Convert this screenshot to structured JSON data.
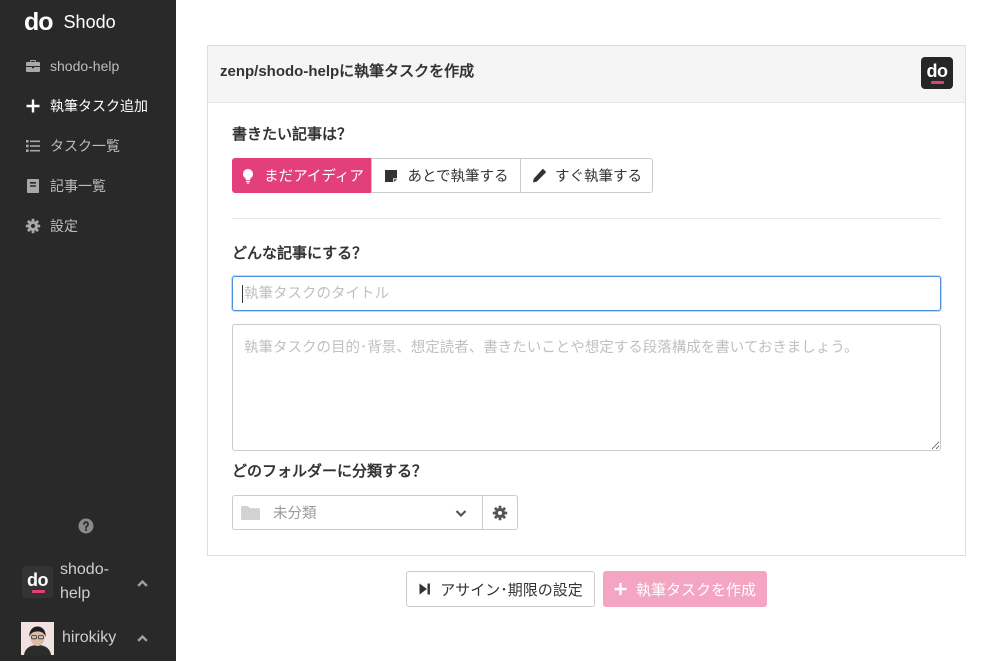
{
  "app": {
    "name": "Shodo",
    "logo_mark": "do"
  },
  "colors": {
    "brand": "#e3407b",
    "brand_disabled": "#f3a5c1",
    "sidebar_background": "#292929",
    "focus_border": "#4f8fe0"
  },
  "sidebar": {
    "items": [
      {
        "label": "shodo-help",
        "icon": "briefcase-icon",
        "active": false
      },
      {
        "label": "執筆タスク追加",
        "icon": "plus-icon",
        "active": true
      },
      {
        "label": "タスク一覧",
        "icon": "list-icon",
        "active": false
      },
      {
        "label": "記事一覧",
        "icon": "book-icon",
        "active": false
      },
      {
        "label": "設定",
        "icon": "gear-icon",
        "active": false
      }
    ],
    "help_icon": "question-circle-icon",
    "workspace": {
      "name": "shodo-help",
      "logo_mark": "do",
      "toggle_icon": "chevron-up-icon"
    },
    "user": {
      "name": "hirokiky",
      "toggle_icon": "chevron-up-icon"
    }
  },
  "form": {
    "title": "zenp/shodo-helpに執筆タスクを作成",
    "logo_mark": "do",
    "status_question": "書きたい記事は？",
    "status_options": [
      {
        "label": "まだアイディア",
        "icon": "lightbulb-icon",
        "selected": true
      },
      {
        "label": "あとで執筆する",
        "icon": "sticky-note-icon",
        "selected": false
      },
      {
        "label": "すぐ執筆する",
        "icon": "pencil-icon",
        "selected": false
      }
    ],
    "content_question": "どんな記事にする？",
    "title_input": {
      "value": "",
      "placeholder": "執筆タスクのタイトル"
    },
    "description_input": {
      "value": "",
      "placeholder": "執筆タスクの目的･背景、想定読者、書きたいことや想定する段落構成を書いておきましょう。"
    },
    "folder_question": "どのフォルダーに分類する？",
    "folder_select": {
      "selected": "未分類",
      "icon": "folder-icon",
      "dropdown_icon": "chevron-down-icon"
    },
    "folder_settings": {
      "icon": "gear-icon"
    }
  },
  "actions": {
    "assign_button": {
      "label": "アサイン･期限の設定",
      "icon": "step-forward-icon"
    },
    "create_button": {
      "label": "執筆タスクを作成",
      "icon": "plus-icon",
      "disabled": true
    }
  }
}
